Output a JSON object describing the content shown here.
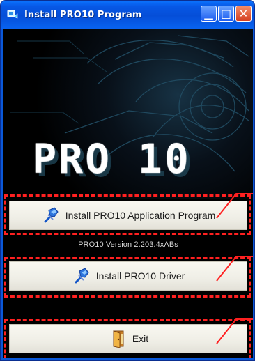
{
  "window": {
    "title": "Install PRO10 Program",
    "title_icon": "installer-icon",
    "controls": {
      "minimize_glyph": "▁",
      "maximize_glyph": "□",
      "close_glyph": "✕"
    }
  },
  "banner": {
    "logo_text": "PRO 10"
  },
  "buttons": {
    "application": {
      "label": "Install PRO10 Application Program",
      "icon": "pushpin-icon"
    },
    "driver": {
      "label": "Install PRO10 Driver",
      "icon": "pushpin-icon"
    },
    "exit": {
      "label": "Exit",
      "icon": "door-exit-icon"
    }
  },
  "version_text": "PRO10 Version 2.203.4xABs",
  "colors": {
    "highlight_red": "#ff2020",
    "title_blue": "#0a58d8",
    "button_face": "#efeee6",
    "close_red": "#d53f21"
  }
}
